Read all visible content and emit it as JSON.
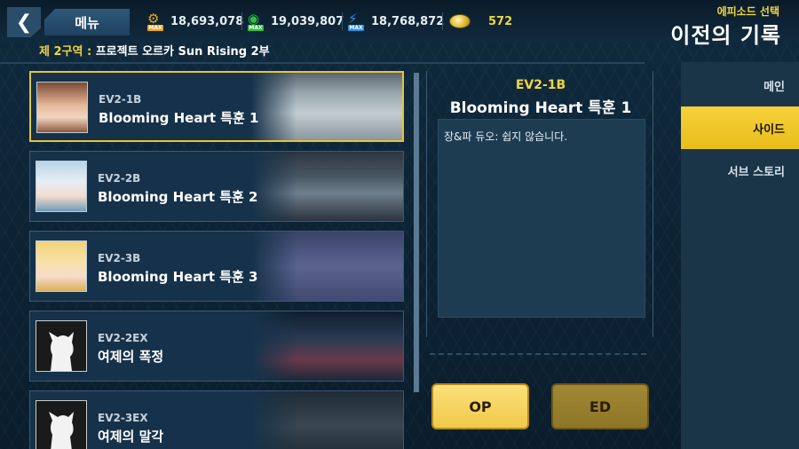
{
  "header": {
    "back_label": "<",
    "menu_label": "메뉴",
    "resources": [
      {
        "icon": "gear-icon",
        "badge": "MAX",
        "color": "#e9a51b",
        "value": "18,693,078"
      },
      {
        "icon": "green-capsule-icon",
        "badge": "MAX",
        "color": "#2bbf3a",
        "value": "19,039,807"
      },
      {
        "icon": "blue-bolt-icon",
        "badge": "MAX",
        "color": "#2e8ee6",
        "value": "18,768,872"
      }
    ],
    "coin": {
      "icon": "gold-coin-icon",
      "value": "572"
    },
    "subtitle": "에피소드 선택",
    "title": "이전의 기록"
  },
  "breadcrumb": {
    "zone": "제 2구역 :",
    "name": " 프로젝트 오르카 Sun Rising 2부"
  },
  "episodes": [
    {
      "code": "EV2-1B",
      "name": "Blooming Heart 특훈 1",
      "selected": true,
      "portrait": "brown-hair-girl"
    },
    {
      "code": "EV2-2B",
      "name": "Blooming Heart 특훈 2",
      "selected": false,
      "portrait": "blue-hair-girl"
    },
    {
      "code": "EV2-3B",
      "name": "Blooming Heart 특훈 3",
      "selected": false,
      "portrait": "blonde-girl"
    },
    {
      "code": "EV2-2EX",
      "name": "여제의 폭정",
      "selected": false,
      "portrait": "silhouette"
    },
    {
      "code": "EV2-3EX",
      "name": "여제의 말각",
      "selected": false,
      "portrait": "silhouette"
    }
  ],
  "detail": {
    "code": "EV2-1B",
    "title": "Blooming Heart 특훈 1",
    "description": "장&파 듀오: 쉽지 않습니다."
  },
  "buttons": {
    "op": "OP",
    "ed": "ED"
  },
  "tabs": [
    {
      "label": "메인",
      "active": false
    },
    {
      "label": "사이드",
      "active": true
    },
    {
      "label": "서브 스토리",
      "active": false
    }
  ],
  "colors": {
    "accent": "#f2d53c",
    "panel": "#16324a",
    "selected_border": "#e6c43a"
  }
}
